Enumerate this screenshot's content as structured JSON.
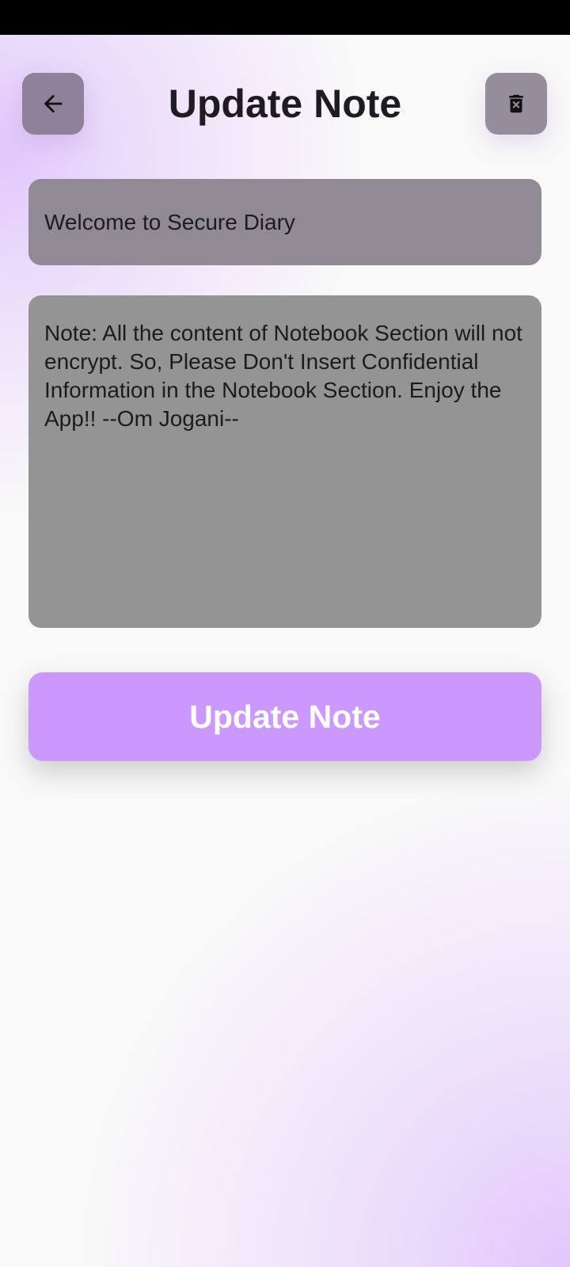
{
  "header": {
    "title": "Update Note",
    "back_icon": "arrow-left-icon",
    "delete_icon": "trash-x-icon"
  },
  "note": {
    "title_value": "Welcome to Secure Diary",
    "content_value": "Note: All the content of Notebook Section will not encrypt. So, Please Don't Insert Confidential Information in the Notebook Section. Enjoy the App!! --Om Jogani--"
  },
  "actions": {
    "update_label": "Update Note"
  },
  "colors": {
    "accent": "#cb98fd",
    "background": "#f9f9f9",
    "gradient": "#e0c4fc",
    "field_bg": "#959595",
    "title_text": "#1f1b23"
  }
}
